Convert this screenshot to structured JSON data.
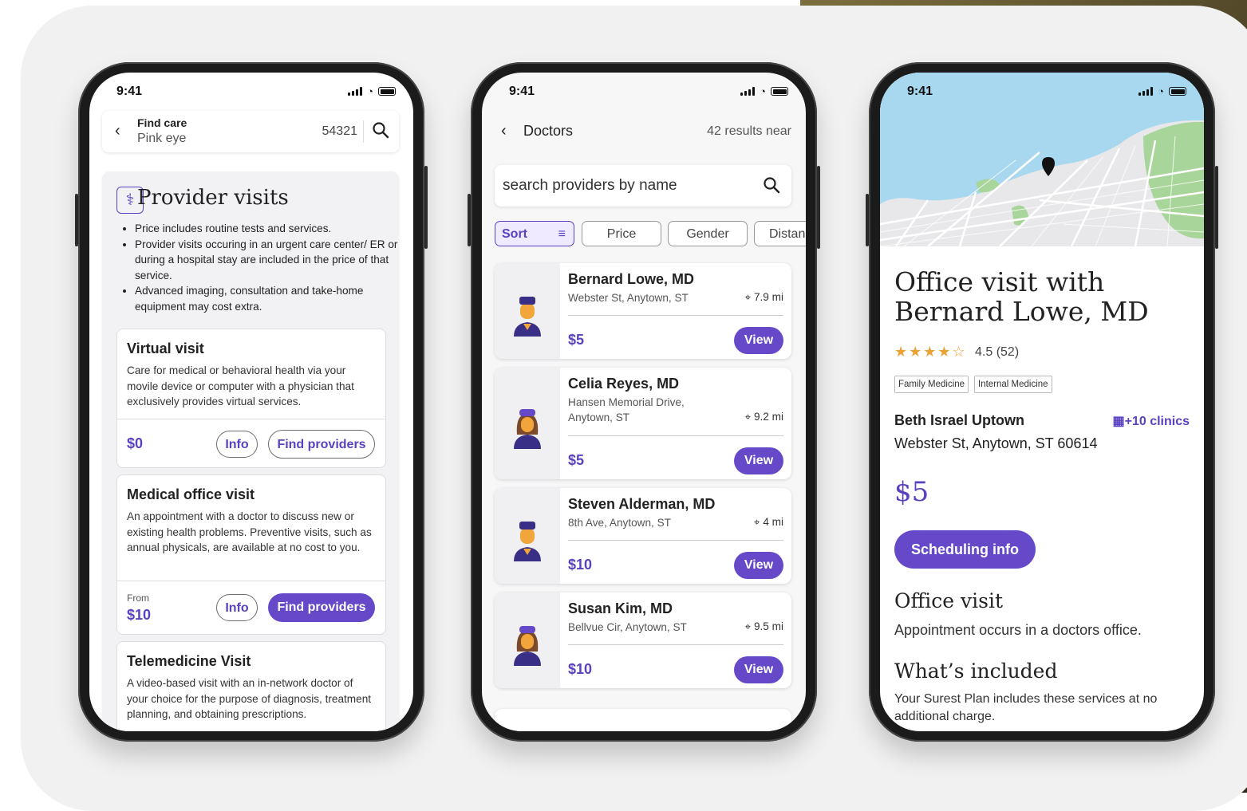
{
  "colors": {
    "accent": "#5b41c1",
    "button_fill": "#6549c9",
    "star": "#e9a233",
    "water": "#a8d8ef",
    "park": "#a8d59a"
  },
  "status_time": "9:41",
  "phone1": {
    "search": {
      "label": "Find care",
      "value": "Pink eye",
      "zip": "54321"
    },
    "title": "Provider visits",
    "bullets": [
      "Price includes routine tests and services.",
      "Provider visits occuring in an urgent care center/ ER or during a hospital stay are included in the price of that service.",
      "Advanced imaging, consultation and take-home equipment may cost extra."
    ],
    "services": [
      {
        "title": "Virtual visit",
        "desc": "Care for medical or behavioral health via your movile device or computer with a physician that exclusively provides virtual services.",
        "from": "",
        "price": "$0",
        "info": "Info",
        "find": "Find providers"
      },
      {
        "title": "Medical office visit",
        "desc": "An appointment with a doctor to discuss new or existing health problems. Preventive visits, such as annual physicals, are available at no cost to you.",
        "from": "From",
        "price": "$10",
        "info": "Info",
        "find": "Find providers"
      },
      {
        "title": "Telemedicine Visit",
        "desc": "A video-based visit with an in-network doctor of your choice for the purpose of diagnosis, treatment planning, and obtaining prescriptions."
      }
    ]
  },
  "phone2": {
    "nav": {
      "title": "Doctors",
      "count": "42 results near"
    },
    "search_placeholder": "search providers by name",
    "chips": [
      "Sort",
      "Price",
      "Gender",
      "Distan"
    ],
    "doctors": [
      {
        "name": "Bernard Lowe, MD",
        "address": "Webster St, Anytown, ST",
        "distance": "7.9 mi",
        "price": "$5",
        "action": "View",
        "avatar": "male-doctor-avatar"
      },
      {
        "name": "Celia Reyes, MD",
        "address": "Hansen Memorial Drive, Anytown, ST",
        "distance": "9.2 mi",
        "price": "$5",
        "action": "View",
        "avatar": "female-doctor-avatar"
      },
      {
        "name": "Steven Alderman, MD",
        "address": "8th Ave, Anytown, ST",
        "distance": "4 mi",
        "price": "$10",
        "action": "View",
        "avatar": "male-doctor-avatar"
      },
      {
        "name": "Susan Kim, MD",
        "address": "Bellvue Cir, Anytown, ST",
        "distance": "9.5 mi",
        "price": "$10",
        "action": "View",
        "avatar": "female-doctor-avatar"
      }
    ]
  },
  "phone3": {
    "title": "Office visit with Bernard Lowe, MD",
    "stars": "★★★★☆",
    "rating": "4.5 (52)",
    "tags": [
      "Family Medicine",
      "Internal Medicine"
    ],
    "clinic": "Beth Israel Uptown",
    "more_clinics": "+10 clinics",
    "address": "Webster St, Anytown, ST 60614",
    "price": "$5",
    "schedule_button": "Scheduling info",
    "section1_title": "Office visit",
    "section1_text": "Appointment occurs in a doctors office.",
    "section2_title": "What’s included",
    "section2_text": "Your Surest Plan includes these services at no additional charge."
  }
}
